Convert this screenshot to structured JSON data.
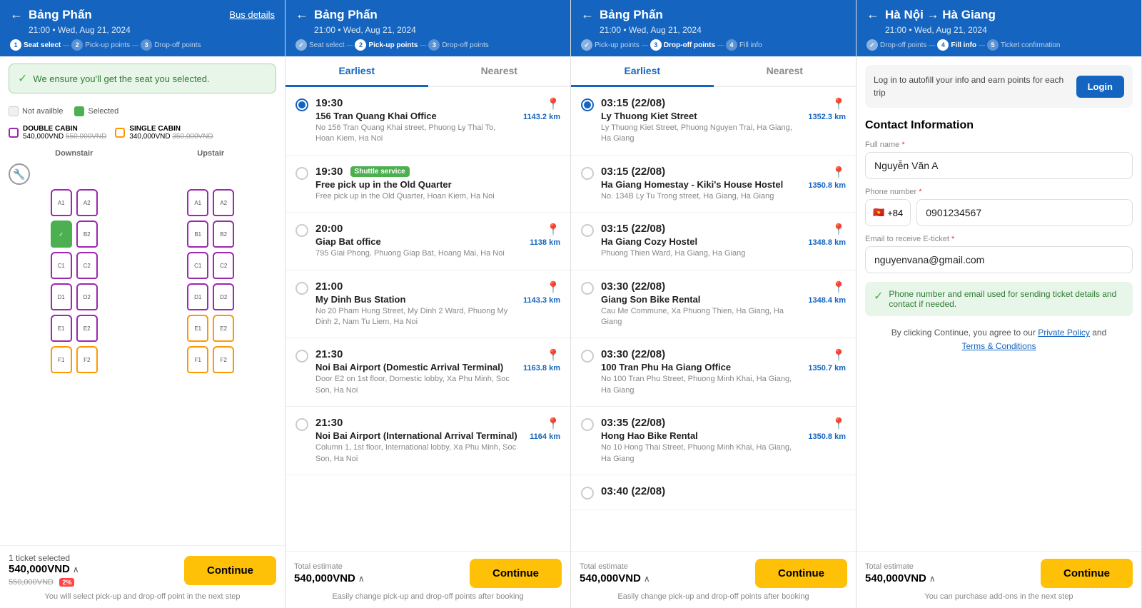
{
  "panels": [
    {
      "id": "panel1",
      "header": {
        "back": "←",
        "title": "Bảng Phấn",
        "subtitle": "21:00 • Wed, Aug 21, 2024",
        "bus_details": "Bus details",
        "steps": [
          {
            "num": "1",
            "label": "Seat select",
            "active": true
          },
          {
            "num": "2",
            "label": "Pick-up points",
            "active": false
          },
          {
            "num": "3",
            "label": "Drop-off points",
            "active": false
          }
        ]
      },
      "notice": "We ensure you'll get the seat you selected.",
      "legend": [
        {
          "type": "unavailable",
          "label": "Not availble"
        },
        {
          "type": "selected",
          "label": "Selected"
        }
      ],
      "cabins": [
        {
          "type": "double",
          "label": "DOUBLE CABIN",
          "price": "540,000VND",
          "old": "550,000VND"
        },
        {
          "type": "single",
          "label": "SINGLE CABIN",
          "price": "340,000VND",
          "old": "350,000VND"
        }
      ],
      "floors": [
        "Downstair",
        "Upstair"
      ],
      "bottom": {
        "ticket_count": "1 ticket selected",
        "price": "540,000VND",
        "old_price": "550,000VND",
        "discount": "2%",
        "continue": "Continue",
        "note": "You will select pick-up and drop-off point in the next step"
      }
    },
    {
      "id": "panel2",
      "header": {
        "back": "←",
        "title": "Bảng Phấn",
        "subtitle": "21:00 • Wed, Aug 21, 2024",
        "steps": [
          {
            "num": "1",
            "label": "Seat select",
            "active": false,
            "done": true
          },
          {
            "num": "2",
            "label": "Pick-up points",
            "active": true
          },
          {
            "num": "3",
            "label": "Drop-off points",
            "active": false
          }
        ]
      },
      "tabs": [
        "Earliest",
        "Nearest"
      ],
      "active_tab": "Earliest",
      "items": [
        {
          "time": "19:30",
          "name": "156 Tran Quang Khai Office",
          "addr": "No 156 Tran Quang Khai street, Phuong Ly Thai To, Hoan Kiem, Ha Noi",
          "dist": "1143.2 km",
          "selected": true,
          "shuttle": false
        },
        {
          "time": "19:30",
          "name": "Free pick up in the Old Quarter",
          "addr": "Free pick up in the Old Quarter, Hoan Kiem, Ha Noi",
          "dist": "",
          "selected": false,
          "shuttle": true
        },
        {
          "time": "20:00",
          "name": "Giap Bat office",
          "addr": "795 Giai Phong, Phuong Giap Bat, Hoang Mai, Ha Noi",
          "dist": "1138 km",
          "selected": false,
          "shuttle": false
        },
        {
          "time": "21:00",
          "name": "My Dinh Bus Station",
          "addr": "No 20 Pham Hung Street, My Dinh 2 Ward, Phuong My Dinh 2, Nam Tu Liem, Ha Noi",
          "dist": "1143.3 km",
          "selected": false,
          "shuttle": false
        },
        {
          "time": "21:30",
          "name": "Noi Bai Airport (Domestic Arrival Terminal)",
          "addr": "Door E2 on 1st floor, Domestic lobby, Xa Phu Minh, Soc Son, Ha Noi",
          "dist": "1163.8 km",
          "selected": false,
          "shuttle": false
        },
        {
          "time": "21:30",
          "name": "Noi Bai Airport (International Arrival Terminal)",
          "addr": "Column 1, 1st floor, International lobby, Xa Phu Minh, Soc Son, Ha Noi",
          "dist": "1164 km",
          "selected": false,
          "shuttle": false
        }
      ],
      "bottom": {
        "label": "Total estimate",
        "price": "540,000VND",
        "continue": "Continue",
        "note": "Easily change pick-up and drop-off points after booking"
      }
    },
    {
      "id": "panel3",
      "header": {
        "back": "←",
        "title": "Bảng Phấn",
        "subtitle": "21:00 • Wed, Aug 21, 2024",
        "steps": [
          {
            "num": "2",
            "label": "Pick-up points",
            "active": false,
            "done": true
          },
          {
            "num": "3",
            "label": "Drop-off points",
            "active": true
          },
          {
            "num": "4",
            "label": "Fill info",
            "active": false
          }
        ]
      },
      "tabs": [
        "Earliest",
        "Nearest"
      ],
      "active_tab": "Earliest",
      "items": [
        {
          "time": "03:15 (22/08)",
          "name": "Ly Thuong Kiet Street",
          "addr": "Ly Thuong Kiet Street, Phuong Nguyen Trai, Ha Giang, Ha Giang",
          "dist": "1352.3 km",
          "selected": true
        },
        {
          "time": "03:15 (22/08)",
          "name": "Ha Giang Homestay - Kiki's House Hostel",
          "addr": "No. 134B Ly Tu Trong street, Ha Giang, Ha Giang",
          "dist": "1350.8 km",
          "selected": false
        },
        {
          "time": "03:15 (22/08)",
          "name": "Ha Giang Cozy Hostel",
          "addr": "Phuong Thien Ward, Ha Giang, Ha Giang",
          "dist": "1348.8 km",
          "selected": false
        },
        {
          "time": "03:30 (22/08)",
          "name": "Giang Son Bike Rental",
          "addr": "Cau Me Commune, Xa Phuong Thien, Ha Giang, Ha Giang",
          "dist": "1348.4 km",
          "selected": false
        },
        {
          "time": "03:30 (22/08)",
          "name": "100 Tran Phu Ha Giang Office",
          "addr": "No 100 Tran Phu Street, Phuong Minh Khai, Ha Giang, Ha Giang",
          "dist": "1350.7 km",
          "selected": false
        },
        {
          "time": "03:35 (22/08)",
          "name": "Hong Hao Bike Rental",
          "addr": "No 10 Hong Thai Street, Phuong Minh Khai, Ha Giang, Ha Giang",
          "dist": "1350.8 km",
          "selected": false
        },
        {
          "time": "03:40 (22/08)",
          "name": "",
          "addr": "",
          "dist": "",
          "selected": false
        }
      ],
      "bottom": {
        "label": "Total estimate",
        "price": "540,000VND",
        "continue": "Continue",
        "note": "Easily change pick-up and drop-off points after booking"
      }
    },
    {
      "id": "panel4",
      "header": {
        "back": "←",
        "title": "Hà Nội → Hà Giang",
        "subtitle": "21:00 • Wed, Aug 21, 2024",
        "steps": [
          {
            "num": "3",
            "label": "Drop-off points",
            "active": false,
            "done": true
          },
          {
            "num": "4",
            "label": "Fill info",
            "active": true
          },
          {
            "num": "5",
            "label": "Ticket confirmation",
            "active": false
          }
        ]
      },
      "login_banner": {
        "text": "Log in to autofill your info and earn points for each trip",
        "btn": "Login"
      },
      "contact_title": "Contact Information",
      "fields": {
        "fullname_label": "Full name",
        "fullname_value": "Nguyễn Văn A",
        "phone_label": "Phone number",
        "phone_flag": "🇻🇳",
        "phone_code": "+84",
        "phone_value": "0901234567",
        "email_label": "Email to receive E-ticket",
        "email_value": "nguyenvana@gmail.com"
      },
      "info_notice": "Phone number and email used for sending ticket details and contact if needed.",
      "policy_text1": "By clicking Continue, you agree to our",
      "policy_link1": "Private Policy",
      "policy_text2": "and",
      "policy_link2": "Terms & Conditions",
      "bottom": {
        "label": "Total estimate",
        "price": "540,000VND",
        "continue": "Continue",
        "note": "You can purchase add-ons in the next step"
      }
    }
  ]
}
